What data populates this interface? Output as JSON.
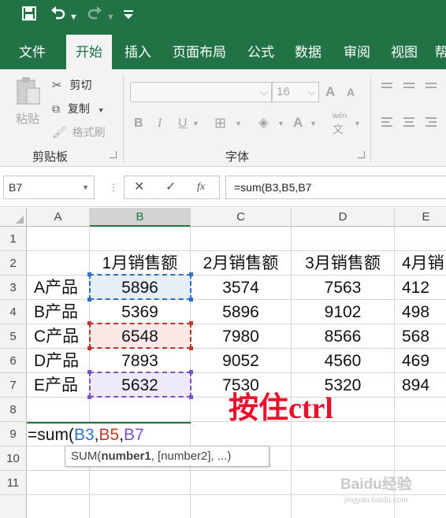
{
  "title_bar": {
    "save_icon": "save-icon",
    "undo_icon": "undo-icon",
    "redo_icon": "redo-icon",
    "customize_icon": "customize-icon"
  },
  "tabs": [
    {
      "label": "文件",
      "active": false
    },
    {
      "label": "开始",
      "active": true
    },
    {
      "label": "插入",
      "active": false
    },
    {
      "label": "页面布局",
      "active": false
    },
    {
      "label": "公式",
      "active": false
    },
    {
      "label": "数据",
      "active": false
    },
    {
      "label": "审阅",
      "active": false
    },
    {
      "label": "视图",
      "active": false
    },
    {
      "label": "帮",
      "active": false
    }
  ],
  "ribbon": {
    "clipboard": {
      "paste_label": "粘贴",
      "cut_label": "剪切",
      "copy_label": "复制",
      "format_painter_label": "格式刷",
      "group_label": "剪贴板"
    },
    "font": {
      "font_name": "",
      "font_size": "16",
      "bold": "B",
      "italic": "I",
      "underline": "U",
      "font_color_letter": "A",
      "phonetic": "wén",
      "grow": "A",
      "shrink": "A",
      "group_label": "字体"
    }
  },
  "formula_bar": {
    "name_box": "B7",
    "cancel": "✕",
    "enter": "✓",
    "fx": "fx",
    "formula": "=sum(B3,B5,B7"
  },
  "columns": [
    "A",
    "B",
    "C",
    "D",
    "E"
  ],
  "rows": [
    "1",
    "2",
    "3",
    "4",
    "5",
    "6",
    "7",
    "8",
    "9",
    "10",
    "11"
  ],
  "headers": {
    "B": "1月销售额",
    "C": "2月销售额",
    "D": "3月销售额",
    "E": "4月销"
  },
  "table": [
    {
      "row": "3",
      "A": "A产品",
      "B": "5896",
      "C": "3574",
      "D": "7563",
      "E": "412"
    },
    {
      "row": "4",
      "A": "B产品",
      "B": "5369",
      "C": "5896",
      "D": "9102",
      "E": "498"
    },
    {
      "row": "5",
      "A": "C产品",
      "B": "6548",
      "C": "7980",
      "D": "8566",
      "E": "568"
    },
    {
      "row": "6",
      "A": "D产品",
      "B": "7893",
      "C": "9052",
      "D": "4560",
      "E": "469"
    },
    {
      "row": "7",
      "A": "E产品",
      "B": "5632",
      "C": "7530",
      "D": "5320",
      "E": "894"
    }
  ],
  "edit_cell": {
    "prefix": "=sum(",
    "ref1": "B3",
    "comma1": ",",
    "ref2": "B5",
    "comma2": ",",
    "ref3": "B7",
    "color_ref1": "#2f6ec9",
    "color_ref2": "#c0392b",
    "color_ref3": "#7b52c9"
  },
  "tooltip": {
    "fn": "SUM(",
    "arg1": "number1",
    "rest": ", [number2], ...)"
  },
  "annotation": "按住ctrl",
  "watermark": {
    "main": "Baidu经验",
    "sub": "jingyan.baidu.com"
  },
  "colors": {
    "brand": "#217346",
    "annotation": "#e8112d",
    "range1": "#2f6ec9",
    "range2": "#c0392b",
    "range3": "#7b52c9"
  }
}
